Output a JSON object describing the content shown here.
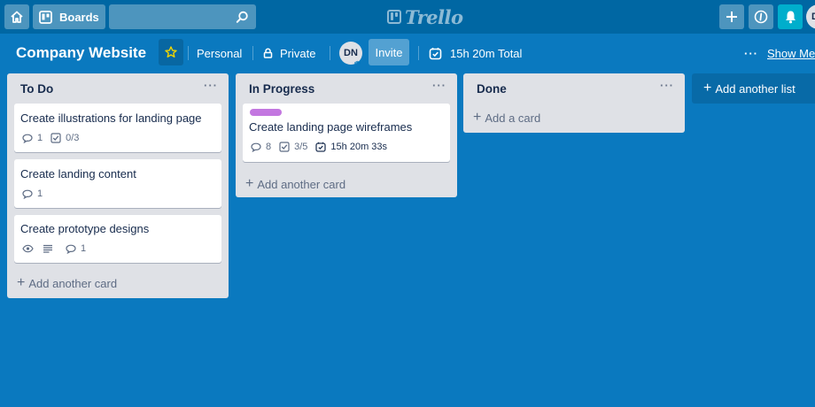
{
  "nav": {
    "boards_label": "Boards",
    "search_value": "",
    "logo_text": "Trello",
    "user_initial": "D"
  },
  "board": {
    "title": "Company Website",
    "team": "Personal",
    "visibility": "Private",
    "member_initials": "DN",
    "invite_label": "Invite",
    "timer_total": "15h 20m Total",
    "menu_label": "Show Menu"
  },
  "lists": [
    {
      "title": "To Do",
      "add_label": "Add another card",
      "cards": [
        {
          "title": "Create illustrations for landing page",
          "comments": "1",
          "checklist": "0/3"
        },
        {
          "title": "Create landing content",
          "comments": "1"
        },
        {
          "title": "Create prototype designs",
          "comments": "1"
        }
      ]
    },
    {
      "title": "In Progress",
      "add_label": "Add another card",
      "cards": [
        {
          "title": "Create landing page wireframes",
          "label_color": "#c377e0",
          "comments": "8",
          "checklist": "3/5",
          "timer": "15h 20m 33s"
        }
      ]
    },
    {
      "title": "Done",
      "add_label": "Add a card",
      "cards": []
    }
  ],
  "add_list_label": "Add another list",
  "colors": {
    "board_bg": "#0a79bf",
    "nav_bg": "#0067a3",
    "notification": "#00aecc",
    "list_bg": "#dfe1e6",
    "card_label": "#c377e0"
  }
}
